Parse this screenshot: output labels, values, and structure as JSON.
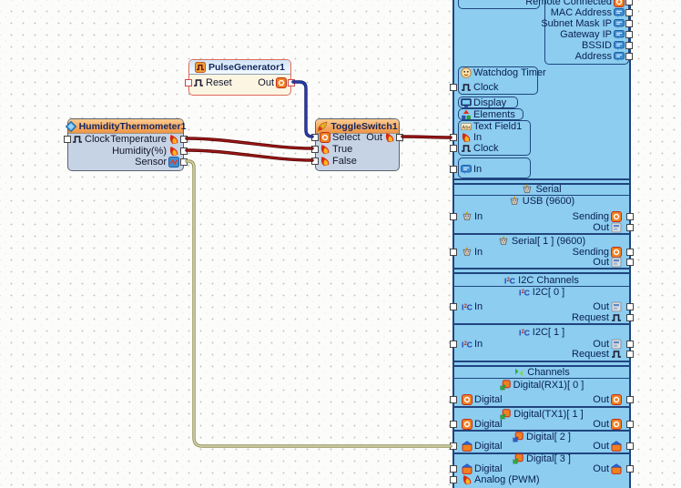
{
  "app": {
    "description": "Visuino-style visual wiring canvas with Arduino board panel"
  },
  "colors": {
    "panel_fill": "#8ccdf0",
    "panel_border": "#20457e",
    "panel_text": "#0a1f52",
    "block_header_orange": "#ef9544",
    "block_header_blue": "#cfe5f7",
    "block_body_blue": "#c6d3e4",
    "block_body_cream": "#fcf5e1",
    "selected_border_red": "#dd6a5a",
    "wires": {
      "digital": {
        "outer": "#141f6e",
        "inner": "#2e43b4"
      },
      "analog": {
        "outer": "#5a0a0a",
        "inner": "#a51616"
      },
      "sensor": {
        "outer": "#8f9058",
        "inner": "#d6d6ad"
      }
    }
  },
  "blocks": [
    {
      "id": "pulse",
      "title": "PulseGenerator1",
      "icon": "pulse-generator-icon",
      "rows": [
        {
          "left": {
            "label": "Reset",
            "icon": "pulse-icon",
            "pin": true
          },
          "right": {
            "label": "Out",
            "icon": "digital-pin-icon",
            "pin": true
          }
        }
      ]
    },
    {
      "id": "humid",
      "title": "HumidityThermometer1",
      "icon": "humidity-thermometer-icon",
      "rows": [
        {
          "left": {
            "label": "Clock",
            "icon": "pulse-icon",
            "pin": true
          },
          "right": {
            "label": "Temperature",
            "icon": "analog-pin-icon",
            "pin": true
          }
        },
        {
          "right": {
            "label": "Humidity(%)",
            "icon": "analog-pin-icon",
            "pin": true
          }
        },
        {
          "right": {
            "label": "Sensor",
            "icon": "sensor-pin-icon",
            "pin": true
          }
        }
      ]
    },
    {
      "id": "toggle",
      "title": "ToggleSwitch1",
      "icon": "toggle-switch-icon",
      "rows": [
        {
          "left": {
            "label": "Select",
            "icon": "digital-pin-icon",
            "pin": true
          },
          "right": {
            "label": "Out",
            "icon": "analog-pin-icon",
            "pin": true
          }
        },
        {
          "left": {
            "label": "True",
            "icon": "analog-pin-icon",
            "pin": true
          }
        },
        {
          "left": {
            "label": "False",
            "icon": "analog-pin-icon",
            "pin": true
          }
        }
      ]
    }
  ],
  "panel": {
    "network_rows": [
      {
        "label": "Remote Connected",
        "icon": "digital-pin-icon",
        "pin": true
      },
      {
        "label": "MAC Address",
        "icon": "text-pin-icon",
        "pin": true
      },
      {
        "label": "Subnet Mask IP",
        "icon": "text-pin-icon",
        "pin": true
      },
      {
        "label": "Gateway IP",
        "icon": "text-pin-icon",
        "pin": true
      },
      {
        "label": "BSSID",
        "icon": "text-pin-icon",
        "pin": true
      },
      {
        "label": "Address",
        "icon": "text-pin-icon",
        "pin": true
      }
    ],
    "tree_boxes": [
      {
        "rows": [
          {
            "label": "Watchdog Timer",
            "icon": "watchdog-icon"
          },
          {
            "label": "Clock",
            "icon": "pulse-icon",
            "pin": true
          }
        ]
      },
      {
        "rows": [
          {
            "label": "Display",
            "icon": "display-icon"
          }
        ]
      },
      {
        "rows": [
          {
            "label": "Elements",
            "icon": "elements-icon"
          }
        ]
      },
      {
        "rows": [
          {
            "label": "Text Field1",
            "icon": "textfield-icon"
          },
          {
            "label": "In",
            "icon": "analog-pin-icon",
            "pin": true
          },
          {
            "label": "Clock",
            "icon": "pulse-icon",
            "pin": true
          }
        ]
      },
      {
        "rows": [
          {
            "label": "In",
            "icon": "text-pin-icon",
            "pin": true
          }
        ]
      }
    ],
    "sections": [
      {
        "title": "Serial",
        "icon": "serial-icon",
        "subs": [
          {
            "title": "USB (9600)",
            "icon": "serial-icon",
            "rows": [
              {
                "left": {
                  "label": "In",
                  "icon": "serial-icon",
                  "pin": true
                },
                "right": {
                  "label": "Sending",
                  "icon": "digital-pin-icon",
                  "pin": true
                }
              },
              {
                "right": {
                  "label": "Out",
                  "icon": "out-icon",
                  "pin": true
                }
              }
            ]
          },
          {
            "title": "Serial[ 1 ] (9600)",
            "icon": "serial-icon",
            "rows": [
              {
                "left": {
                  "label": "In",
                  "icon": "serial-icon",
                  "pin": true
                },
                "right": {
                  "label": "Sending",
                  "icon": "digital-pin-icon",
                  "pin": true
                }
              },
              {
                "right": {
                  "label": "Out",
                  "icon": "out-icon",
                  "pin": true
                }
              }
            ]
          }
        ]
      },
      {
        "title": "I2C Channels",
        "icon": "i2c-icon",
        "subs": [
          {
            "title": "I2C[ 0 ]",
            "icon": "i2c-icon",
            "rows": [
              {
                "left": {
                  "label": "In",
                  "icon": "i2c-icon",
                  "pin": true
                },
                "right": {
                  "label": "Out",
                  "icon": "out-icon",
                  "pin": true
                }
              },
              {
                "right": {
                  "label": "Request",
                  "icon": "pulse-icon",
                  "pin": true
                }
              }
            ]
          },
          {
            "title": "I2C[ 1 ]",
            "icon": "i2c-icon",
            "rows": [
              {
                "left": {
                  "label": "In",
                  "icon": "i2c-icon",
                  "pin": true
                },
                "right": {
                  "label": "Out",
                  "icon": "out-icon",
                  "pin": true
                }
              },
              {
                "right": {
                  "label": "Request",
                  "icon": "pulse-icon",
                  "pin": true
                }
              }
            ]
          }
        ]
      },
      {
        "title": "Channels",
        "icon": "channels-icon",
        "subs": [
          {
            "title": "Digital(RX1)[ 0 ]",
            "icon": "digital-green-icon",
            "rows": [
              {
                "left": {
                  "label": "Digital",
                  "icon": "digital-pin-icon",
                  "pin": true
                },
                "right": {
                  "label": "Out",
                  "icon": "digital-pin-icon",
                  "pin": true
                }
              }
            ]
          },
          {
            "title": "Digital(TX1)[ 1 ]",
            "icon": "digital-green-icon",
            "rows": [
              {
                "left": {
                  "label": "Digital",
                  "icon": "digital-pin-icon",
                  "pin": true
                },
                "right": {
                  "label": "Out",
                  "icon": "digital-pin-icon",
                  "pin": true
                }
              }
            ]
          },
          {
            "title": "Digital[ 2 ]",
            "icon": "digital-blue-icon",
            "rows": [
              {
                "left": {
                  "label": "Digital",
                  "icon": "bidir-pin-icon",
                  "pin": true
                },
                "right": {
                  "label": "Out",
                  "icon": "bidir-pin-icon",
                  "pin": true
                }
              }
            ]
          },
          {
            "title": "Digital[ 3 ]",
            "icon": "digital-green-icon",
            "rows": [
              {
                "left": {
                  "label": "Digital",
                  "icon": "bidir-pin-icon",
                  "pin": true
                },
                "right": {
                  "label": "Out",
                  "icon": "bidir-pin-icon",
                  "pin": true
                }
              },
              {
                "left": {
                  "label": "Analog (PWM)",
                  "icon": "analog-pin-icon",
                  "pin": true
                }
              }
            ]
          }
        ]
      }
    ]
  },
  "wires": [
    {
      "name": "wire-pulse-out-to-select",
      "type": "digital"
    },
    {
      "name": "wire-temperature-to-true",
      "type": "analog"
    },
    {
      "name": "wire-humidity-to-false",
      "type": "analog"
    },
    {
      "name": "wire-toggle-out-to-textfield-in",
      "type": "analog"
    },
    {
      "name": "wire-sensor-to-digital2",
      "type": "sensor"
    }
  ]
}
